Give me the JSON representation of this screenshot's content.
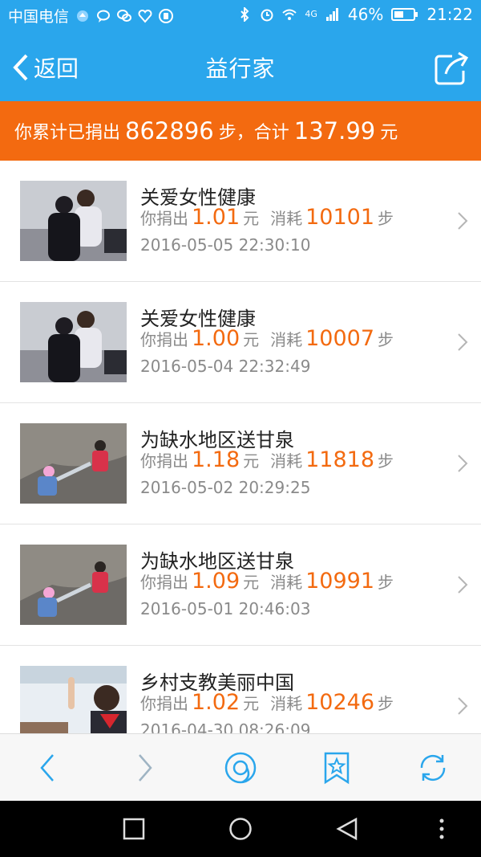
{
  "status_bar": {
    "carrier": "中国电信",
    "network": "4G",
    "battery": "46%",
    "time": "21:22",
    "icons": [
      "carrier-badge-icon",
      "chat-icon",
      "wechat-icon",
      "heart-icon",
      "hand-icon",
      "bluetooth-icon",
      "alarm-icon",
      "wifi-icon",
      "signal-icon",
      "battery-icon"
    ]
  },
  "nav": {
    "back_label": "返回",
    "title": "益行家",
    "share_icon": "share-icon"
  },
  "summary": {
    "prefix": "你累计已捐出",
    "steps": "862896",
    "steps_unit": "步，合计",
    "amount": "137.99",
    "amount_unit": "元"
  },
  "donations": [
    {
      "title": "关爱女性健康",
      "donate_label": "你捐出",
      "amount": "1.01",
      "amount_unit": "元",
      "consume_label": "消耗",
      "steps": "10101",
      "steps_unit": "步",
      "time": "2016-05-05 22:30:10",
      "thumb": "hug-photo"
    },
    {
      "title": "关爱女性健康",
      "donate_label": "你捐出",
      "amount": "1.00",
      "amount_unit": "元",
      "consume_label": "消耗",
      "steps": "10007",
      "steps_unit": "步",
      "time": "2016-05-04 22:32:49",
      "thumb": "hug-photo"
    },
    {
      "title": "为缺水地区送甘泉",
      "donate_label": "你捐出",
      "amount": "1.18",
      "amount_unit": "元",
      "consume_label": "消耗",
      "steps": "11818",
      "steps_unit": "步",
      "time": "2016-05-02 20:29:25",
      "thumb": "water-photo"
    },
    {
      "title": "为缺水地区送甘泉",
      "donate_label": "你捐出",
      "amount": "1.09",
      "amount_unit": "元",
      "consume_label": "消耗",
      "steps": "10991",
      "steps_unit": "步",
      "time": "2016-05-01 20:46:03",
      "thumb": "water-photo"
    },
    {
      "title": "乡村支教美丽中国",
      "donate_label": "你捐出",
      "amount": "1.02",
      "amount_unit": "元",
      "consume_label": "消耗",
      "steps": "10246",
      "steps_unit": "步",
      "time": "2016-04-30 08:26:09",
      "thumb": "classroom-photo"
    }
  ],
  "toolbar": {
    "icons": [
      "back-arrow-icon",
      "forward-arrow-icon",
      "qq-browser-icon",
      "bookmark-star-icon",
      "refresh-icon"
    ]
  },
  "colors": {
    "primary": "#2aa6ec",
    "accent": "#f36a10",
    "text": "#222222",
    "muted": "#8a8a8a"
  }
}
